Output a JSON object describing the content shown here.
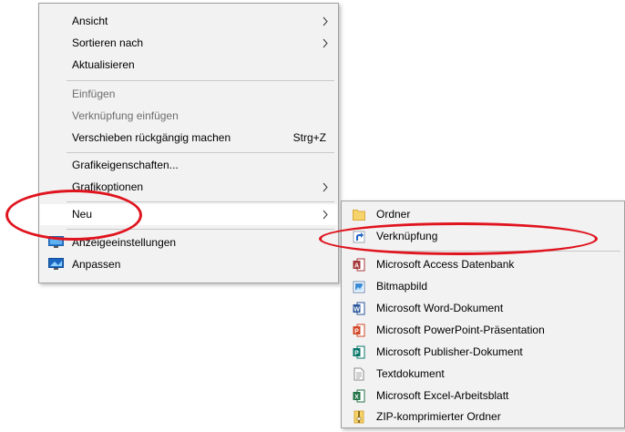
{
  "main_menu": {
    "items": [
      {
        "label": "Ansicht",
        "submenu": true
      },
      {
        "label": "Sortieren nach",
        "submenu": true
      },
      {
        "label": "Aktualisieren"
      },
      {
        "label": "Einfügen",
        "disabled": true
      },
      {
        "label": "Verknüpfung einfügen",
        "disabled": true
      },
      {
        "label": "Verschieben rückgängig machen",
        "shortcut": "Strg+Z"
      },
      {
        "label": "Grafikeigenschaften..."
      },
      {
        "label": "Grafikoptionen",
        "submenu": true
      },
      {
        "label": "Neu",
        "submenu": true,
        "highlighted": true
      },
      {
        "label": "Anzeigeeinstellungen",
        "icon": "display-settings-icon"
      },
      {
        "label": "Anpassen",
        "icon": "personalize-icon"
      }
    ]
  },
  "sub_menu": {
    "items": [
      {
        "label": "Ordner",
        "icon": "folder-icon"
      },
      {
        "label": "Verknüpfung",
        "icon": "shortcut-icon"
      },
      {
        "label": "Microsoft Access Datenbank",
        "icon": "access-icon"
      },
      {
        "label": "Bitmapbild",
        "icon": "bitmap-icon"
      },
      {
        "label": "Microsoft Word-Dokument",
        "icon": "word-icon"
      },
      {
        "label": "Microsoft PowerPoint-Präsentation",
        "icon": "powerpoint-icon"
      },
      {
        "label": "Microsoft Publisher-Dokument",
        "icon": "publisher-icon"
      },
      {
        "label": "Textdokument",
        "icon": "text-document-icon"
      },
      {
        "label": "Microsoft Excel-Arbeitsblatt",
        "icon": "excel-icon"
      },
      {
        "label": "ZIP-komprimierter Ordner",
        "icon": "zip-folder-icon"
      }
    ]
  },
  "colors": {
    "menu_bg": "#f2f2f2",
    "highlight_bg": "#ffffff",
    "disabled_text": "#6d6d6d",
    "annotation_red": "#e0141e"
  }
}
